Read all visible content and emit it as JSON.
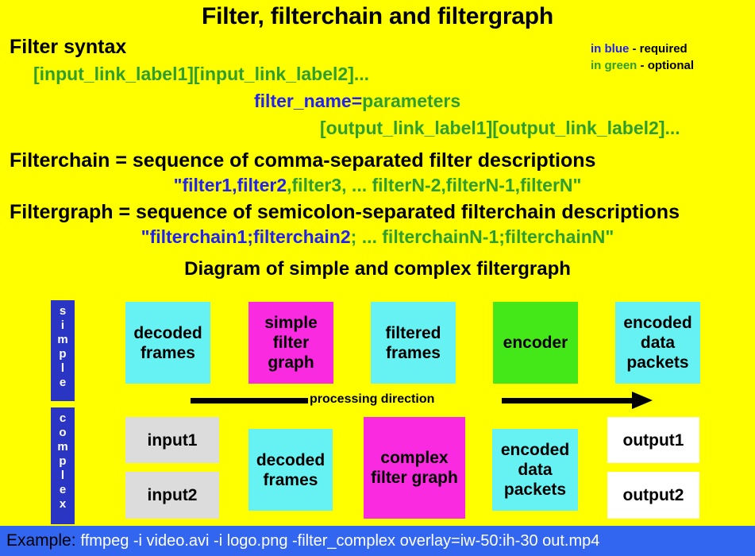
{
  "slide": {
    "title": "Filter, filterchain and filtergraph",
    "background_color": "#ffff00"
  },
  "colors": {
    "required_blue": "#2222ee",
    "optional_green": "#2e9e2e",
    "cyan_node": "#66f2f2",
    "magenta_node": "#f92ae0",
    "green_node": "#44e818",
    "grey_node": "#dcdcdc",
    "white_node": "#ffffff",
    "label_blue": "#2a35c4",
    "bar_blue": "#3366f0"
  },
  "legend": {
    "blue_word": "in blue",
    "blue_meaning": "- required",
    "green_word": "in green",
    "green_meaning": "- optional"
  },
  "syntax": {
    "heading": "Filter syntax",
    "input_links": "[input_link_label1][input_link_label2]...",
    "filter_name": "filter_name=",
    "parameters": "parameters",
    "output_links": "[output_link_label1][output_link_label2]..."
  },
  "filterchain": {
    "heading": "Filterchain = sequence of comma-separated filter descriptions",
    "example_required": "\"filter1,filter2",
    "example_optional": ",filter3, ... filterN-2,filterN-1,filterN\""
  },
  "filtergraph": {
    "heading": "Filtergraph = sequence of semicolon-separated filterchain descriptions",
    "example_required": "\"filterchain1;filterchain2",
    "example_optional": "; ... filterchainN-1;filterchainN\""
  },
  "diagram": {
    "heading": "Diagram of simple and complex filtergraph",
    "row_labels": {
      "simple": "simple",
      "complex": "complex"
    },
    "arrow_label": "processing direction",
    "simple_row": [
      {
        "label": "decoded frames",
        "color": "#66f2f2"
      },
      {
        "label": "simple filter graph",
        "color": "#f92ae0"
      },
      {
        "label": "filtered frames",
        "color": "#66f2f2"
      },
      {
        "label": "encoder",
        "color": "#44e818"
      },
      {
        "label": "encoded data packets",
        "color": "#66f2f2"
      }
    ],
    "complex_row": [
      {
        "label": "input1",
        "color": "#dcdcdc"
      },
      {
        "label": "input2",
        "color": "#dcdcdc"
      },
      {
        "label": "decoded frames",
        "color": "#66f2f2"
      },
      {
        "label": "complex filter graph",
        "color": "#f92ae0"
      },
      {
        "label": "encoded data packets",
        "color": "#66f2f2"
      },
      {
        "label": "output1",
        "color": "#ffffff"
      },
      {
        "label": "output2",
        "color": "#ffffff"
      }
    ]
  },
  "example": {
    "label": "Example:",
    "command": "ffmpeg -i video.avi -i logo.png -filter_complex overlay=iw-50:ih-30  out.mp4"
  }
}
